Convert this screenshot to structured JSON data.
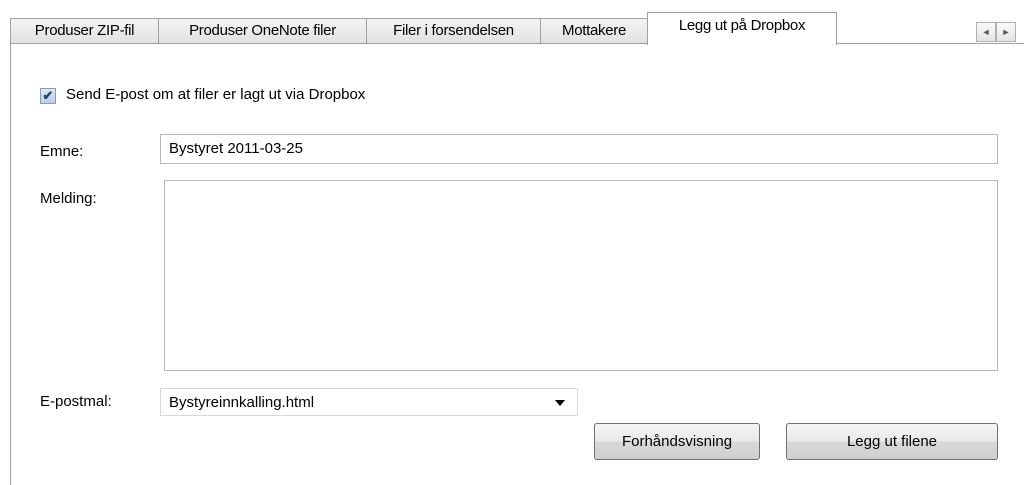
{
  "tabs": [
    {
      "label": "Produser ZIP-fil"
    },
    {
      "label": "Produser OneNote filer"
    },
    {
      "label": "Filer i forsendelsen"
    },
    {
      "label": "Mottakere"
    },
    {
      "label": "Legg ut på Dropbox",
      "active": true
    }
  ],
  "tab_scroll": {
    "left_glyph": "◄",
    "right_glyph": "►"
  },
  "send_email": {
    "label": "Send E-post om at filer er lagt ut via Dropbox",
    "checked": true,
    "check_glyph": "✔"
  },
  "subject": {
    "label": "Emne:",
    "value": "Bystyret 2011-03-25"
  },
  "message": {
    "label": "Melding:",
    "value": ""
  },
  "template": {
    "label": "E-postmal:",
    "selected": "Bystyreinnkalling.html"
  },
  "buttons": {
    "preview": "Forhåndsvisning",
    "publish": "Legg ut filene"
  }
}
